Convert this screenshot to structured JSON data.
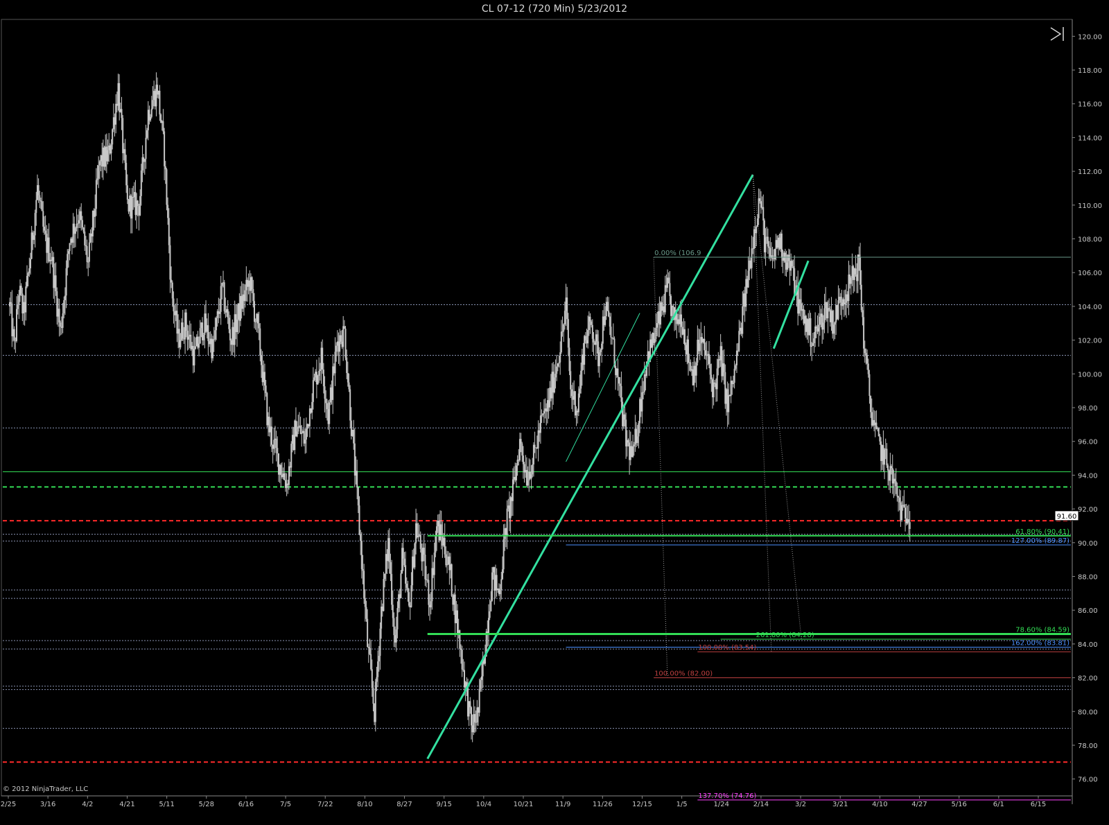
{
  "window": {
    "title": "CL 07-12 (720 Min)  5/23/2012"
  },
  "copyright": "© 2012 NinjaTrader, LLC",
  "icons": {
    "scroll_end": "skip-to-end-icon"
  },
  "colors": {
    "background": "#000000",
    "candles": "#c8c8c8",
    "trend": "#33e0a0",
    "fib_green": "#33dd55",
    "support_red": "#ff2a2a",
    "support_blue": "#4a90ff",
    "magenta": "#ff44ff",
    "dotted_grey": "#8b95b5"
  },
  "chart_data": {
    "type": "candlestick",
    "title": "CL 07-12 (720 Min)  5/23/2012",
    "ylim": [
      75,
      121
    ],
    "y_ticks": [
      "76.00",
      "78.00",
      "80.00",
      "82.00",
      "84.00",
      "86.00",
      "88.00",
      "90.00",
      "92.00",
      "94.00",
      "96.00",
      "98.00",
      "100.00",
      "102.00",
      "104.00",
      "106.00",
      "108.00",
      "110.00",
      "112.00",
      "114.00",
      "116.00",
      "118.00",
      "120.00"
    ],
    "x_ticks": [
      "2/25",
      "3/16",
      "4/2",
      "4/21",
      "5/11",
      "5/28",
      "6/16",
      "7/5",
      "7/22",
      "8/10",
      "8/27",
      "9/15",
      "10/4",
      "10/21",
      "11/9",
      "11/26",
      "12/15",
      "1/5",
      "1/24",
      "2/14",
      "3/2",
      "3/21",
      "4/10",
      "4/27",
      "5/16",
      "6/1",
      "6/15"
    ],
    "last_price": "91.60",
    "price_path": [
      [
        0,
        104
      ],
      [
        2,
        101.5
      ],
      [
        4,
        105
      ],
      [
        6,
        103.5
      ],
      [
        9,
        107
      ],
      [
        12,
        111
      ],
      [
        15,
        108
      ],
      [
        18,
        107
      ],
      [
        22,
        102.5
      ],
      [
        26,
        108
      ],
      [
        30,
        109.5
      ],
      [
        34,
        106.5
      ],
      [
        39,
        112.5
      ],
      [
        43,
        113
      ],
      [
        47,
        117
      ],
      [
        51,
        110
      ],
      [
        56,
        110
      ],
      [
        60,
        115.5
      ],
      [
        64,
        117
      ],
      [
        67,
        113
      ],
      [
        70,
        105
      ],
      [
        73,
        102
      ],
      [
        76,
        103
      ],
      [
        80,
        101
      ],
      [
        84,
        103
      ],
      [
        88,
        101.5
      ],
      [
        92,
        105
      ],
      [
        96,
        102
      ],
      [
        100,
        104
      ],
      [
        104,
        105.5
      ],
      [
        108,
        102
      ],
      [
        112,
        97
      ],
      [
        116,
        95
      ],
      [
        120,
        93.5
      ],
      [
        124,
        97
      ],
      [
        128,
        96
      ],
      [
        131,
        99
      ],
      [
        135,
        101
      ],
      [
        138,
        97.5
      ],
      [
        142,
        102
      ],
      [
        145,
        102.5
      ],
      [
        148,
        97
      ],
      [
        152,
        90
      ],
      [
        155,
        84
      ],
      [
        158,
        80
      ],
      [
        161,
        86
      ],
      [
        164,
        90
      ],
      [
        167,
        84
      ],
      [
        170,
        89
      ],
      [
        173,
        86
      ],
      [
        176,
        91
      ],
      [
        179,
        89
      ],
      [
        182,
        86.5
      ],
      [
        185,
        91
      ],
      [
        188,
        90
      ],
      [
        191,
        88
      ],
      [
        194,
        85
      ],
      [
        197,
        82
      ],
      [
        200,
        79
      ],
      [
        203,
        80
      ],
      [
        206,
        84
      ],
      [
        209,
        88
      ],
      [
        212,
        87
      ],
      [
        215,
        91
      ],
      [
        218,
        93
      ],
      [
        221,
        96
      ],
      [
        224,
        94
      ],
      [
        227,
        95
      ],
      [
        230,
        97
      ],
      [
        233,
        98
      ],
      [
        236,
        100
      ],
      [
        239,
        102
      ],
      [
        241,
        104
      ],
      [
        243,
        99
      ],
      [
        246,
        98
      ],
      [
        249,
        102
      ],
      [
        252,
        103
      ],
      [
        255,
        101
      ],
      [
        258,
        104
      ],
      [
        261,
        102
      ],
      [
        264,
        99
      ],
      [
        267,
        96
      ],
      [
        270,
        95
      ],
      [
        273,
        98
      ],
      [
        276,
        101
      ],
      [
        279,
        102
      ],
      [
        282,
        103.5
      ],
      [
        285,
        105
      ],
      [
        288,
        103
      ],
      [
        291,
        103.5
      ],
      [
        294,
        101
      ],
      [
        296,
        100
      ],
      [
        299,
        102
      ],
      [
        302,
        101
      ],
      [
        305,
        99
      ],
      [
        308,
        101
      ],
      [
        311,
        98
      ],
      [
        314,
        100
      ],
      [
        317,
        103
      ],
      [
        320,
        106
      ],
      [
        323,
        109
      ],
      [
        325,
        110.5
      ],
      [
        327,
        108
      ],
      [
        330,
        106.5
      ],
      [
        333,
        108
      ],
      [
        336,
        107
      ],
      [
        339,
        106
      ],
      [
        342,
        104
      ],
      [
        345,
        103
      ],
      [
        348,
        102
      ],
      [
        351,
        103
      ],
      [
        354,
        104
      ],
      [
        357,
        103
      ],
      [
        360,
        104.5
      ],
      [
        363,
        105
      ],
      [
        366,
        106
      ],
      [
        368,
        106.5
      ],
      [
        370,
        102
      ],
      [
        373,
        98
      ],
      [
        376,
        96
      ],
      [
        379,
        95
      ],
      [
        382,
        94
      ],
      [
        385,
        92.5
      ],
      [
        387,
        91.5
      ],
      [
        389,
        92
      ],
      [
        390,
        91.6
      ]
    ],
    "trend_lines": [
      {
        "d0": 181,
        "p0": 77.2,
        "d1": 322,
        "p1": 111.8,
        "width": 3
      },
      {
        "d0": 241,
        "p0": 94.8,
        "d1": 273,
        "p1": 103.6,
        "width": 1
      },
      {
        "d0": 331,
        "p0": 101.5,
        "d1": 346,
        "p1": 106.7,
        "width": 3
      }
    ],
    "dotted_lines": [
      {
        "d0": 322,
        "p0": 111.8,
        "d1": 343,
        "p1": 84.3
      },
      {
        "d0": 322,
        "p0": 111.8,
        "d1": 330,
        "p1": 83.5
      },
      {
        "d0": 279,
        "p0": 106.9,
        "d1": 285,
        "p1": 81.9
      }
    ],
    "levels": [
      {
        "price": 104.1,
        "color": "#8b95b5",
        "dash": "2,2",
        "width": 1
      },
      {
        "price": 101.1,
        "color": "#8b95b5",
        "dash": "2,2",
        "width": 1
      },
      {
        "price": 96.8,
        "color": "#8b95b5",
        "dash": "2,2",
        "width": 1
      },
      {
        "price": 94.2,
        "color": "#33dd55",
        "dash": "",
        "width": 1
      },
      {
        "price": 93.3,
        "color": "#33dd55",
        "dash": "6,4",
        "width": 2
      },
      {
        "price": 91.3,
        "color": "#ff2a2a",
        "dash": "6,4",
        "width": 2
      },
      {
        "price": 90.5,
        "color": "#8b95b5",
        "dash": "2,2",
        "width": 1
      },
      {
        "price": 90.1,
        "color": "#8b95b5",
        "dash": "2,2",
        "width": 1
      },
      {
        "price": 87.2,
        "color": "#8b95b5",
        "dash": "2,2",
        "width": 1
      },
      {
        "price": 86.7,
        "color": "#8b95b5",
        "dash": "2,2",
        "width": 1
      },
      {
        "price": 84.2,
        "color": "#8b95b5",
        "dash": "2,2",
        "width": 1
      },
      {
        "price": 83.7,
        "color": "#8b95b5",
        "dash": "2,2",
        "width": 1
      },
      {
        "price": 81.5,
        "color": "#8b95b5",
        "dash": "2,2",
        "width": 1
      },
      {
        "price": 81.3,
        "color": "#8b95b5",
        "dash": "2,2",
        "width": 1
      },
      {
        "price": 79.0,
        "color": "#8b95b5",
        "dash": "2,2",
        "width": 1
      },
      {
        "price": 77.0,
        "color": "#ff2a2a",
        "dash": "6,4",
        "width": 2
      }
    ],
    "fib_lines": [
      {
        "label": "0.00% (106.9",
        "price": 106.91,
        "start": 279,
        "color": "#6a9a8a",
        "width": 1,
        "label_pos": "left"
      },
      {
        "label": "61.80% (90.41)",
        "price": 90.41,
        "start": 181,
        "color": "#33dd55",
        "width": 2,
        "label_pos": "right"
      },
      {
        "label": "127.00% (89.87)",
        "price": 89.87,
        "start": 241,
        "color": "#4a90ff",
        "width": 1,
        "label_pos": "right"
      },
      {
        "label": "78.60% (84.59)",
        "price": 84.59,
        "start": 181,
        "color": "#33dd55",
        "width": 3,
        "label_pos": "right"
      },
      {
        "label": "261.80% (84.28)",
        "price": 84.28,
        "start": 308,
        "color": "#33dd55",
        "width": 1,
        "label_pos": "mid"
      },
      {
        "label": "162.00% (83.81)",
        "price": 83.81,
        "start": 241,
        "color": "#4a90ff",
        "width": 1,
        "label_pos": "right"
      },
      {
        "label": "100.00% (83.54)",
        "price": 83.54,
        "start": 298,
        "color": "#c04040",
        "width": 1,
        "label_pos": "left"
      },
      {
        "label": "100.00% (82.00)",
        "price": 82.0,
        "start": 279,
        "color": "#c04040",
        "width": 1,
        "label_pos": "left"
      },
      {
        "label": "137.70% (74.76)",
        "price": 74.76,
        "start": 298,
        "color": "#ff44ff",
        "width": 1,
        "label_pos": "left"
      }
    ]
  }
}
